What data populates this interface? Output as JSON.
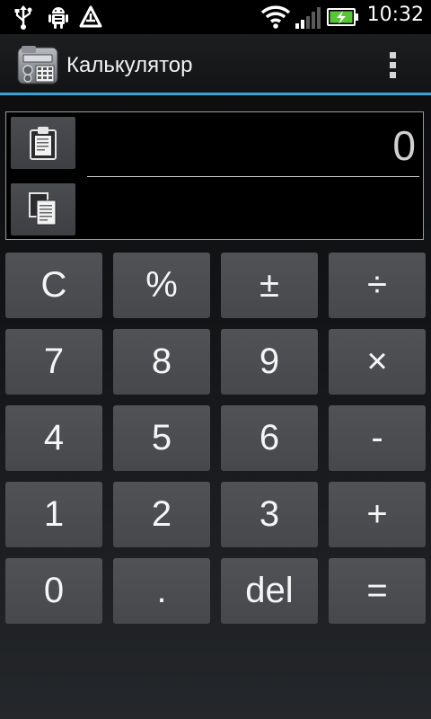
{
  "status_bar": {
    "time": "10:32",
    "icons": [
      "usb-icon",
      "android-debug-icon",
      "notification-triangle-icon",
      "wifi-icon",
      "signal-icon",
      "battery-charging-icon"
    ]
  },
  "action_bar": {
    "title": "Калькулятор",
    "app_icon": "calculator-app-icon",
    "menu_icon": "overflow-menu-icon"
  },
  "display": {
    "value": "0",
    "secondary": "",
    "paste_icon": "clipboard-paste-icon",
    "copy_icon": "copy-icon"
  },
  "keypad": {
    "rows": [
      [
        "C",
        "%",
        "±",
        "÷"
      ],
      [
        "7",
        "8",
        "9",
        "×"
      ],
      [
        "4",
        "5",
        "6",
        "-"
      ],
      [
        "1",
        "2",
        "3",
        "+"
      ],
      [
        "0",
        ".",
        "del",
        "="
      ]
    ]
  },
  "colors": {
    "accent": "#33a5d8",
    "key_bg": "#4b4d50",
    "key_text": "#f5f5f5"
  }
}
